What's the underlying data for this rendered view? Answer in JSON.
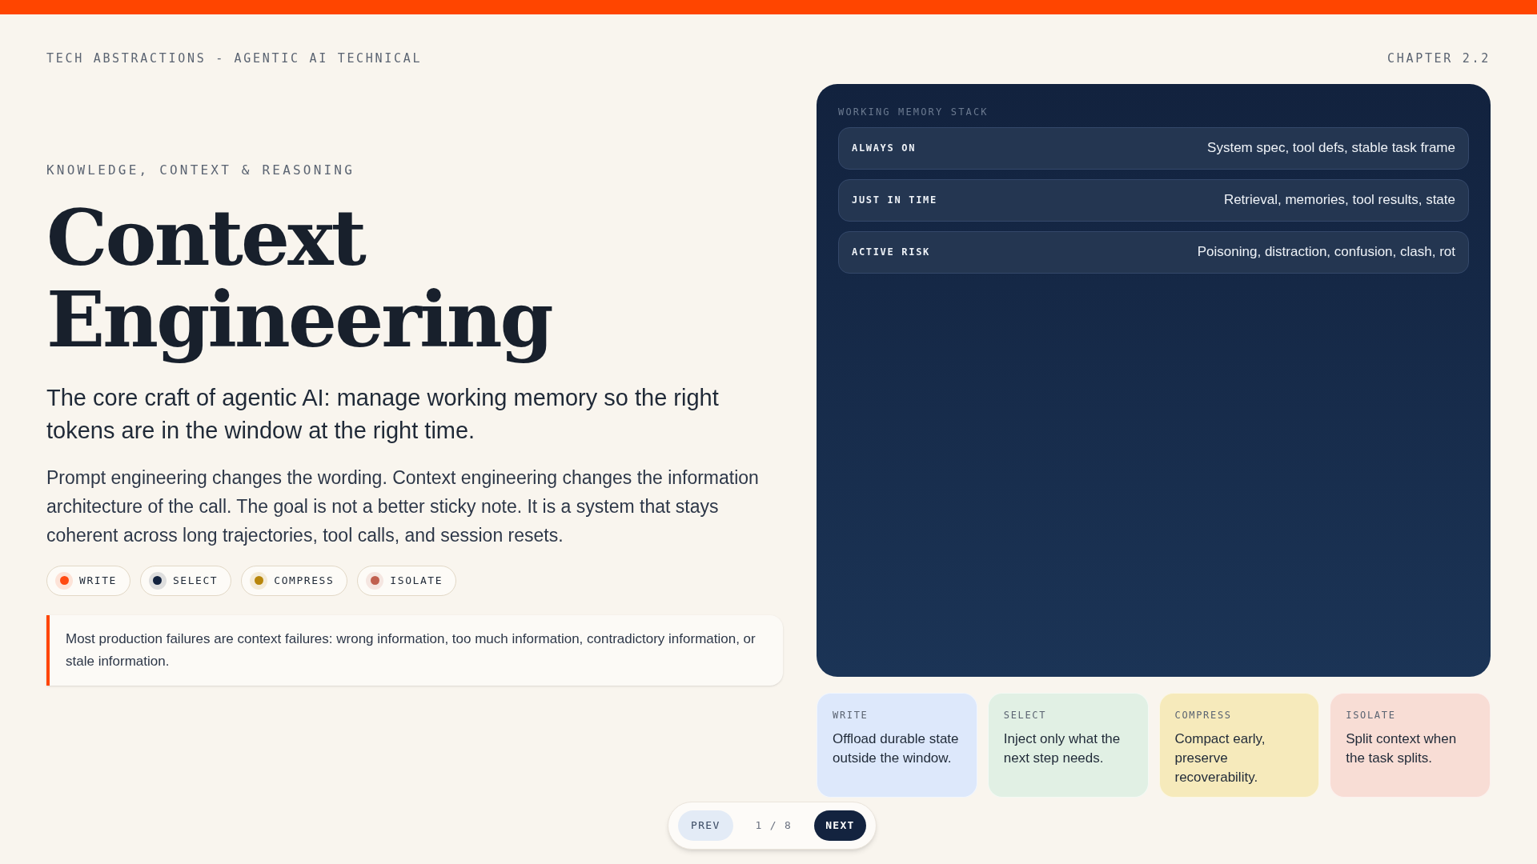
{
  "header": {
    "left": "TECH ABSTRACTIONS - AGENTIC AI TECHNICAL",
    "right": "CHAPTER 2.2"
  },
  "kicker": "KNOWLEDGE, CONTEXT & REASONING",
  "title": [
    "Context",
    "Engineering"
  ],
  "lead": "The core craft of agentic AI: manage working memory so the right tokens are in the window at the right time.",
  "body": "Prompt engineering changes the wording. Context engineering changes the information architecture of the call. The goal is not a better sticky note. It is a system that stays coherent across long trajectories, tool calls, and session resets.",
  "chips": [
    {
      "label": "WRITE",
      "color": "#ff4a12"
    },
    {
      "label": "SELECT",
      "color": "#13233f"
    },
    {
      "label": "COMPRESS",
      "color": "#b8860b"
    },
    {
      "label": "ISOLATE",
      "color": "#c0604f"
    }
  ],
  "callout": "Most production failures are context failures: wrong information, too much information, contradictory information, or stale information.",
  "memory_stack": {
    "title": "WORKING MEMORY STACK",
    "rows": [
      {
        "label": "ALWAYS ON",
        "value": "System spec, tool defs, stable task frame"
      },
      {
        "label": "JUST IN TIME",
        "value": "Retrieval, memories, tool results, state"
      },
      {
        "label": "ACTIVE RISK",
        "value": "Poisoning, distraction, confusion, clash, rot"
      }
    ]
  },
  "cards": [
    {
      "label": "WRITE",
      "text": "Offload durable state outside the window.",
      "color": "#dde8fb"
    },
    {
      "label": "SELECT",
      "text": "Inject only what the next step needs.",
      "color": "#e1f0e4"
    },
    {
      "label": "COMPRESS",
      "text": "Compact early, preserve recoverability.",
      "color": "#f6eabb"
    },
    {
      "label": "ISOLATE",
      "text": "Split context when the task splits.",
      "color": "#f8ddd5"
    }
  ],
  "pager": {
    "prev": "PREV",
    "position": "1 / 8",
    "next": "NEXT"
  }
}
